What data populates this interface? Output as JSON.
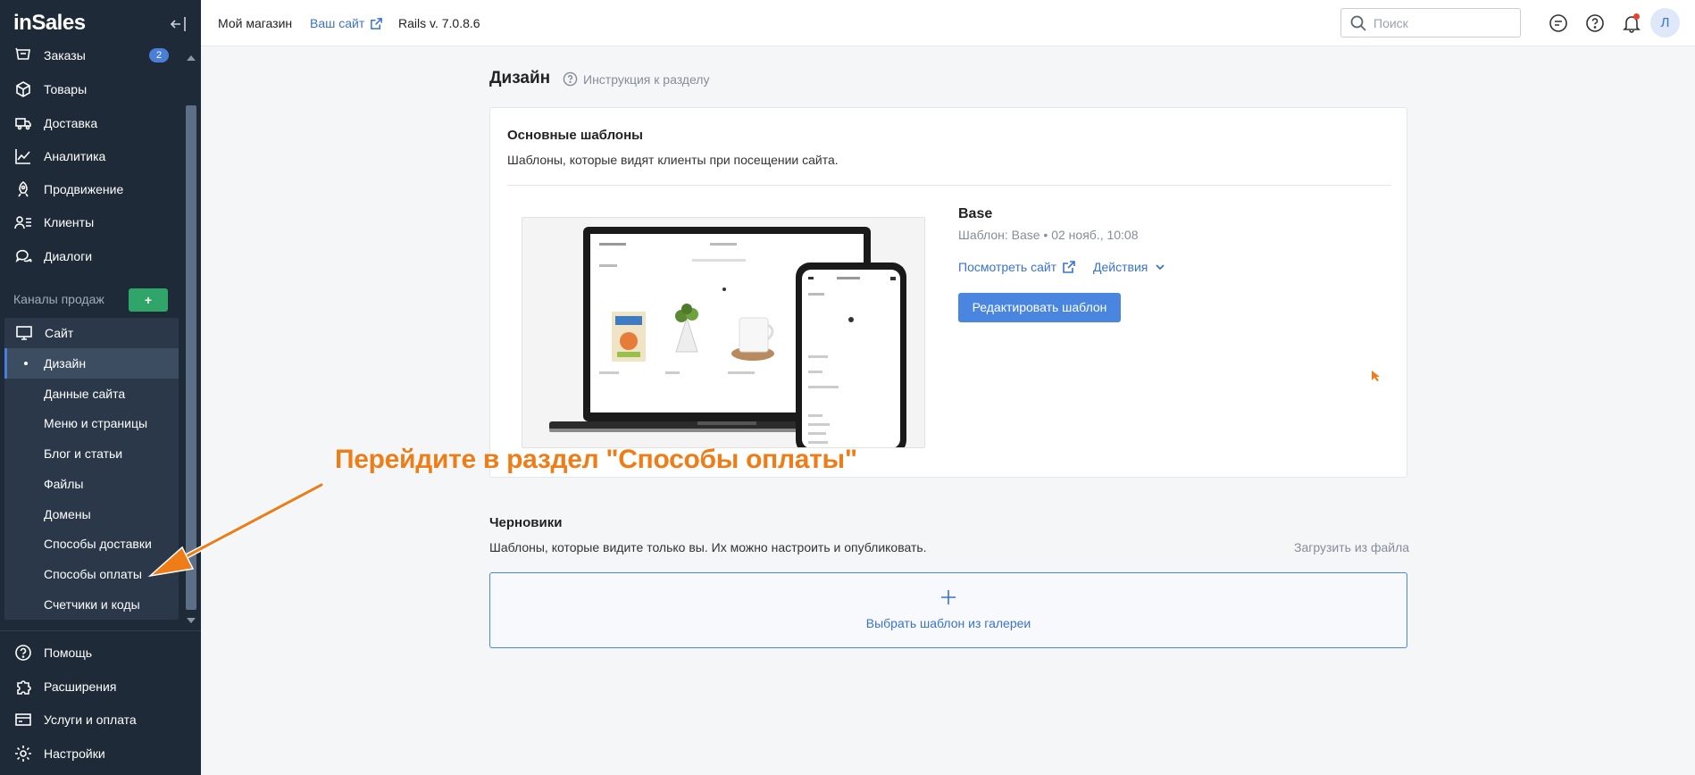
{
  "sidebar": {
    "logo": "inSales",
    "items_top": [
      {
        "label": "Заказы",
        "icon": "cart-icon",
        "badge": "2"
      },
      {
        "label": "Товары",
        "icon": "box-icon"
      },
      {
        "label": "Доставка",
        "icon": "truck-icon"
      },
      {
        "label": "Аналитика",
        "icon": "chart-line-icon"
      },
      {
        "label": "Продвижение",
        "icon": "rocket-icon"
      },
      {
        "label": "Клиенты",
        "icon": "clients-icon"
      },
      {
        "label": "Диалоги",
        "icon": "chat-icon"
      }
    ],
    "channels_label": "Каналы продаж",
    "channels_add": "+",
    "site": {
      "label": "Сайт",
      "icon": "monitor-icon"
    },
    "site_items": [
      {
        "label": "Дизайн",
        "active": true
      },
      {
        "label": "Данные сайта"
      },
      {
        "label": "Меню и страницы"
      },
      {
        "label": "Блог и статьи"
      },
      {
        "label": "Файлы"
      },
      {
        "label": "Домены"
      },
      {
        "label": "Способы доставки"
      },
      {
        "label": "Способы оплаты"
      },
      {
        "label": "Счетчики и коды"
      }
    ],
    "items_bottom": [
      {
        "label": "Помощь",
        "icon": "help-icon"
      },
      {
        "label": "Расширения",
        "icon": "puzzle-icon"
      },
      {
        "label": "Услуги и оплата",
        "icon": "billing-icon"
      },
      {
        "label": "Настройки",
        "icon": "gear-icon"
      }
    ]
  },
  "topbar": {
    "shop_name": "Мой магазин",
    "your_site": "Ваш сайт",
    "rails": "Rails v. 7.0.8.6",
    "search_placeholder": "Поиск",
    "avatar": "Л"
  },
  "main": {
    "title": "Дизайн",
    "instruction": "Инструкция к разделу",
    "main_templates": {
      "title": "Основные шаблоны",
      "subtitle": "Шаблоны, которые видят клиенты при посещении сайта.",
      "template_name": "Base",
      "template_meta": "Шаблон: Base • 02 нояб., 10:08",
      "view_site": "Посмотреть сайт",
      "actions": "Действия",
      "edit_button": "Редактировать шаблон"
    },
    "drafts": {
      "title": "Черновики",
      "subtitle": "Шаблоны, которые видите только вы. Их можно настроить и опубликовать.",
      "upload": "Загрузить из файла",
      "gallery": "Выбрать шаблон из галереи"
    }
  },
  "annotation": {
    "text": "Перейдите в раздел \"Способы оплаты\"",
    "color": "#f07c18"
  },
  "colors": {
    "sidebar_bg": "#1e2a38",
    "accent": "#4a86e0",
    "add_green": "#2fa56a"
  }
}
